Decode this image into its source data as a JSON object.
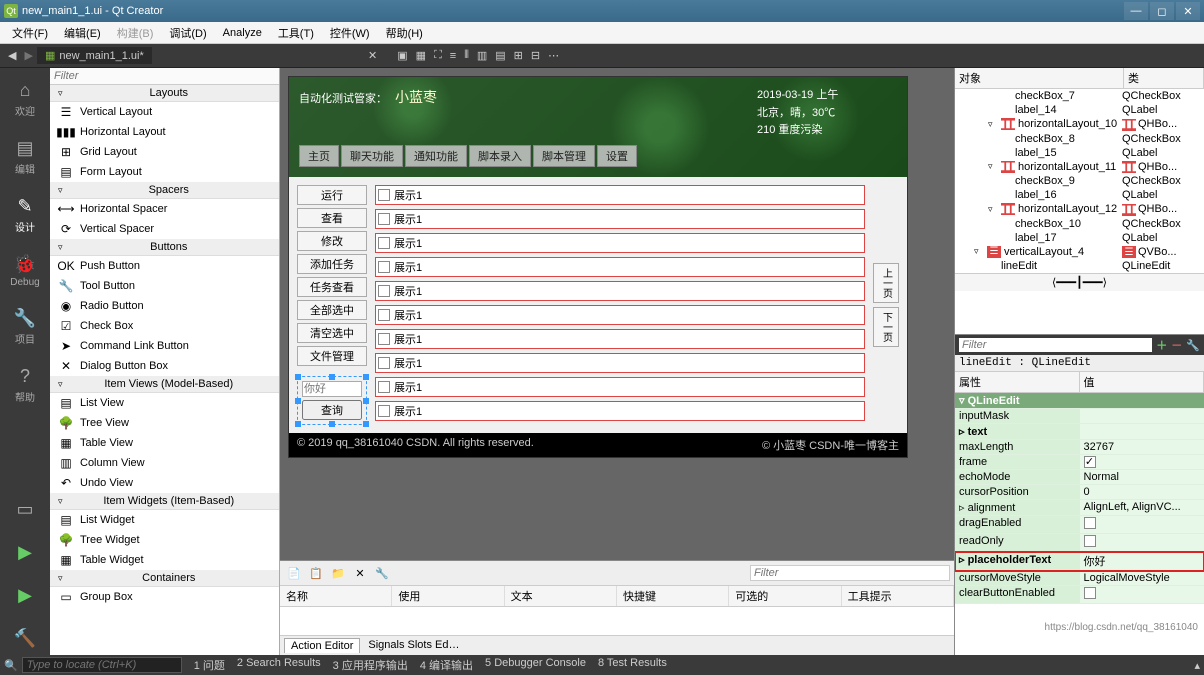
{
  "window": {
    "title": "new_main1_1.ui - Qt Creator"
  },
  "menubar": [
    "文件(F)",
    "编辑(E)",
    "构建(B)",
    "调试(D)",
    "Analyze",
    "工具(T)",
    "控件(W)",
    "帮助(H)"
  ],
  "tab": {
    "label": "new_main1_1.ui*"
  },
  "modes": [
    "欢迎",
    "编辑",
    "设计",
    "Debug",
    "项目",
    "帮助"
  ],
  "widgetbox": {
    "filter": "Filter",
    "categories": [
      {
        "name": "Layouts",
        "items": [
          "Vertical Layout",
          "Horizontal Layout",
          "Grid Layout",
          "Form Layout"
        ]
      },
      {
        "name": "Spacers",
        "items": [
          "Horizontal Spacer",
          "Vertical Spacer"
        ]
      },
      {
        "name": "Buttons",
        "items": [
          "Push Button",
          "Tool Button",
          "Radio Button",
          "Check Box",
          "Command Link Button",
          "Dialog Button Box"
        ]
      },
      {
        "name": "Item Views (Model-Based)",
        "items": [
          "List View",
          "Tree View",
          "Table View",
          "Column View",
          "Undo View"
        ]
      },
      {
        "name": "Item Widgets (Item-Based)",
        "items": [
          "List Widget",
          "Tree Widget",
          "Table Widget"
        ]
      },
      {
        "name": "Containers",
        "items": [
          "Group Box"
        ]
      }
    ]
  },
  "design": {
    "banner": {
      "title_prefix": "自动化测试管家：",
      "title_name": "小蓝枣",
      "tabs": [
        "主页",
        "聊天功能",
        "通知功能",
        "脚本录入",
        "脚本管理",
        "设置"
      ],
      "info": [
        "2019-03-19 上午",
        "北京，晴，30℃",
        "210 重度污染"
      ]
    },
    "left_buttons": [
      "运行",
      "查看",
      "修改",
      "添加任务",
      "任务查看",
      "全部选中",
      "清空选中",
      "文件管理"
    ],
    "rows": [
      "展示1",
      "展示1",
      "展示1",
      "展示1",
      "展示1",
      "展示1",
      "展示1",
      "展示1",
      "展示1",
      "展示1"
    ],
    "page_buttons": [
      "上一页",
      "下一页"
    ],
    "selected": {
      "placeholder": "你好",
      "button": "查询"
    },
    "footer_left": "© 2019 qq_38161040 CSDN. All rights reserved.",
    "footer_right": "© 小蓝枣 CSDN-唯一博客主"
  },
  "action_editor": {
    "filter": "Filter",
    "columns": [
      "名称",
      "使用",
      "文本",
      "快捷键",
      "可选的",
      "工具提示"
    ],
    "tabs": [
      "Action Editor",
      "Signals Slots Ed…"
    ]
  },
  "object_inspector": {
    "header": [
      "对象",
      "类"
    ],
    "rows": [
      {
        "indent": 3,
        "name": "checkBox_7",
        "class": "QCheckBox",
        "exp": ""
      },
      {
        "indent": 3,
        "name": "label_14",
        "class": "QLabel",
        "exp": ""
      },
      {
        "indent": 2,
        "name": "horizontalLayout_10",
        "class": "QHBo...",
        "exp": "▿",
        "icon": "h"
      },
      {
        "indent": 3,
        "name": "checkBox_8",
        "class": "QCheckBox",
        "exp": ""
      },
      {
        "indent": 3,
        "name": "label_15",
        "class": "QLabel",
        "exp": ""
      },
      {
        "indent": 2,
        "name": "horizontalLayout_11",
        "class": "QHBo...",
        "exp": "▿",
        "icon": "h"
      },
      {
        "indent": 3,
        "name": "checkBox_9",
        "class": "QCheckBox",
        "exp": ""
      },
      {
        "indent": 3,
        "name": "label_16",
        "class": "QLabel",
        "exp": ""
      },
      {
        "indent": 2,
        "name": "horizontalLayout_12",
        "class": "QHBo...",
        "exp": "▿",
        "icon": "h"
      },
      {
        "indent": 3,
        "name": "checkBox_10",
        "class": "QCheckBox",
        "exp": ""
      },
      {
        "indent": 3,
        "name": "label_17",
        "class": "QLabel",
        "exp": ""
      },
      {
        "indent": 1,
        "name": "verticalLayout_4",
        "class": "QVBo...",
        "exp": "▿",
        "icon": "v"
      },
      {
        "indent": 2,
        "name": "lineEdit",
        "class": "QLineEdit",
        "exp": ""
      }
    ]
  },
  "property_editor": {
    "filter": "Filter",
    "info": "lineEdit : QLineEdit",
    "header": [
      "属性",
      "值"
    ],
    "class_header": "QLineEdit",
    "rows": [
      {
        "name": "inputMask",
        "val": "",
        "exp": false
      },
      {
        "name": "text",
        "val": "",
        "exp": true,
        "bold": true
      },
      {
        "name": "maxLength",
        "val": "32767",
        "exp": false
      },
      {
        "name": "frame",
        "val": "",
        "check": true,
        "exp": false
      },
      {
        "name": "echoMode",
        "val": "Normal",
        "exp": false
      },
      {
        "name": "cursorPosition",
        "val": "0",
        "exp": false
      },
      {
        "name": "alignment",
        "val": "AlignLeft, AlignVC...",
        "exp": true
      },
      {
        "name": "dragEnabled",
        "val": "",
        "check": false,
        "exp": false
      },
      {
        "name": "readOnly",
        "val": "",
        "check": false,
        "exp": false
      },
      {
        "name": "placeholderText",
        "val": "你好",
        "exp": true,
        "bold": true,
        "highlight": true
      },
      {
        "name": "cursorMoveStyle",
        "val": "LogicalMoveStyle",
        "exp": false
      },
      {
        "name": "clearButtonEnabled",
        "val": "",
        "check": false,
        "exp": false
      }
    ]
  },
  "statusbar": {
    "locate": "Type to locate (Ctrl+K)",
    "items": [
      "1 问题",
      "2 Search Results",
      "3 应用程序输出",
      "4 编译输出",
      "5 Debugger Console",
      "8 Test Results"
    ]
  },
  "watermark": "https://blog.csdn.net/qq_38161040"
}
